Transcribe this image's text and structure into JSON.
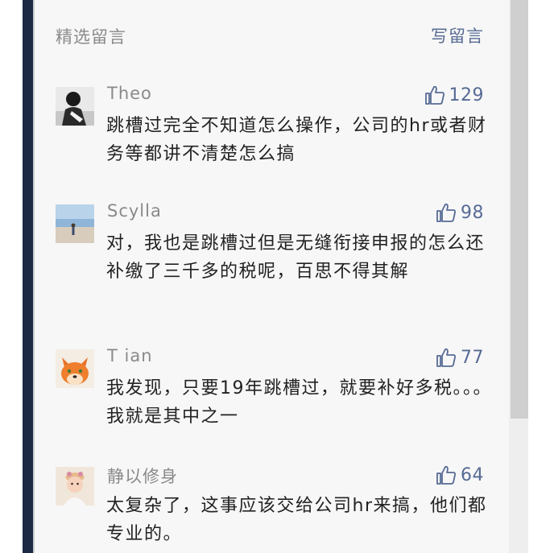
{
  "header": {
    "section_title": "精选留言",
    "write_comment_label": "写留言"
  },
  "colors": {
    "link": "#576b95",
    "meta_text": "#8a8a8a",
    "body_text": "#222222",
    "panel_bg": "#f7f7f7",
    "frame_dark": "#1d2a44"
  },
  "comments": [
    {
      "nickname": "Theo",
      "likes": "129",
      "content": "跳槽过完全不知道怎么操作，公司的hr或者财务等都讲不清楚怎么搞",
      "avatar_icon": "person-photo-avatar-icon"
    },
    {
      "nickname": "Scylla",
      "likes": "98",
      "content": "对，我也是跳槽过但是无缝衔接申报的怎么还补缴了三千多的税呢，百思不得其解",
      "avatar_icon": "beach-photo-avatar-icon"
    },
    {
      "nickname": "T ian",
      "likes": "77",
      "content": "我发现，只要19年跳槽过，就要补好多税。。。我就是其中之一",
      "avatar_icon": "fox-cartoon-avatar-icon"
    },
    {
      "nickname": "静以修身",
      "likes": "64",
      "content": "太复杂了，这事应该交给公司hr来搞，他们都专业的。",
      "avatar_icon": "baby-photo-avatar-icon"
    }
  ]
}
